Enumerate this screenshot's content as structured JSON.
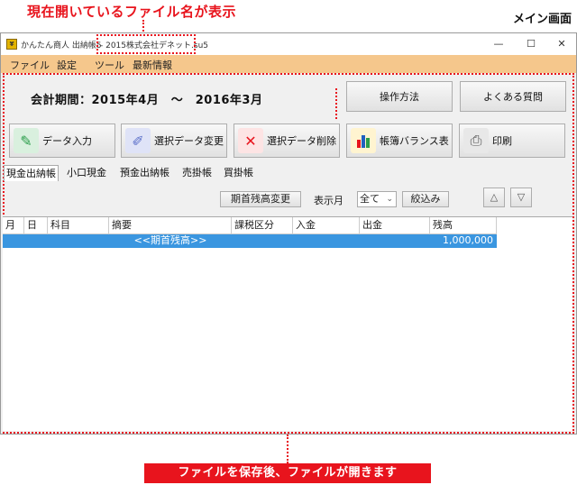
{
  "annotations": {
    "top": "現在開いているファイル名が表示",
    "main_screen": "メイン画面",
    "bottom": "ファイルを保存後、ファイルが開きます"
  },
  "window": {
    "app_icon": "app-icon",
    "title": "かんたん商人 出納帳5",
    "file_name": "- 2015株式会社デネット.su5",
    "buttons": {
      "minimize": "—",
      "maximize": "☐",
      "close": "✕"
    }
  },
  "menu": [
    "ファイル",
    "設定",
    "ツール",
    "最新情報"
  ],
  "period": {
    "label": "会計期間：2015年4月　〜　2016年3月"
  },
  "help_buttons": {
    "manual": "操作方法",
    "faq": "よくある質問"
  },
  "toolbar": [
    {
      "label": "データ入力",
      "icon": "pencil-icon",
      "color": "#2a9d4a"
    },
    {
      "label": "選択データ変更",
      "icon": "edit-icon",
      "color": "#5b6fc9"
    },
    {
      "label": "選択データ削除",
      "icon": "delete-x-icon",
      "color": "#e8141d"
    },
    {
      "label": "帳簿バランス表",
      "icon": "bar-chart-icon",
      "color": "#2060c0"
    },
    {
      "label": "印刷",
      "icon": "printer-icon",
      "color": "#666666"
    }
  ],
  "tabs": [
    "現金出納帳",
    "小口現金",
    "預金出納帳",
    "売掛帳",
    "買掛帳"
  ],
  "filters": {
    "opening_balance_change": "期首残高変更",
    "month_label": "表示月",
    "month_value": "全て",
    "narrow_button": "絞込み",
    "up_arrow": "△",
    "down_arrow": "▽"
  },
  "table": {
    "columns": [
      "月",
      "日",
      "科目",
      "摘要",
      "課税区分",
      "入金",
      "出金",
      "残高"
    ],
    "rows": [
      {
        "month": "",
        "day": "",
        "account": "",
        "description": "<<期首残高>>",
        "tax": "",
        "income": "",
        "expense": "",
        "balance": "1,000,000"
      }
    ]
  },
  "colors": {
    "accent_red": "#e8141d",
    "menu_bg": "#f5c78c",
    "selected_row": "#3a96e0"
  }
}
